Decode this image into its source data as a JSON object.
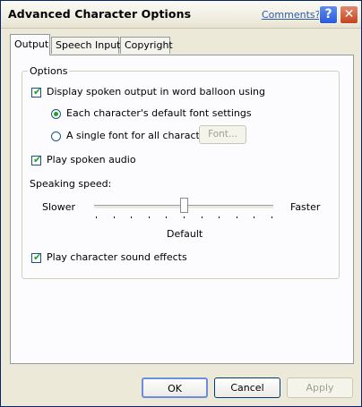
{
  "window": {
    "title": "Advanced Character Options",
    "comments_link": "Comments?",
    "help_glyph": "?",
    "close_glyph": "✕"
  },
  "tabs": [
    {
      "label": "Output",
      "active": true
    },
    {
      "label": "Speech Input",
      "active": false
    },
    {
      "label": "Copyright",
      "active": false
    }
  ],
  "options_group": {
    "legend": "Options",
    "display_balloon": {
      "label": "Display spoken output in word balloon using",
      "checked": true
    },
    "font_radio_default": {
      "label": "Each character's default font settings",
      "selected": true
    },
    "font_radio_single": {
      "label": "A single font for all characters",
      "selected": false
    },
    "font_button": "Font...",
    "play_audio": {
      "label": "Play spoken audio",
      "checked": true
    },
    "speaking_speed": {
      "label": "Speaking speed:",
      "slower": "Slower",
      "faster": "Faster",
      "default": "Default",
      "value_fraction": 0.5
    },
    "sound_effects": {
      "label": "Play character sound effects",
      "checked": true
    }
  },
  "buttons": {
    "ok": "OK",
    "cancel": "Cancel",
    "apply": "Apply"
  },
  "colors": {
    "check_green": "#21a121",
    "title_blue_link": "#2f5aa8"
  }
}
